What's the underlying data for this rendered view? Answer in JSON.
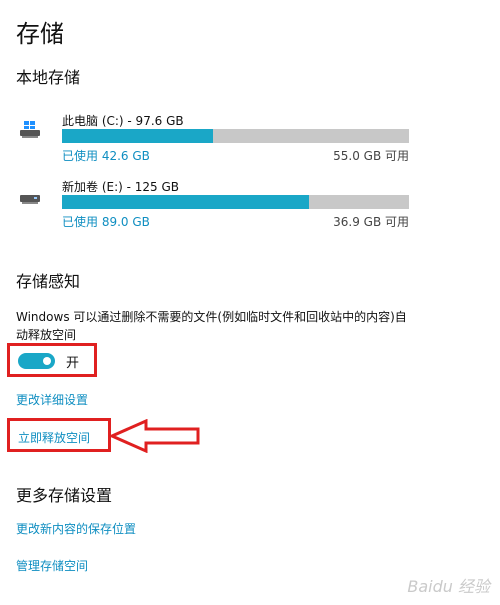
{
  "page": {
    "title": "存储"
  },
  "local_storage": {
    "heading": "本地存储",
    "drives": [
      {
        "name": "此电脑 (C:) - 97.6 GB",
        "used": "已使用 42.6 GB",
        "free": "55.0 GB 可用",
        "used_fraction": 0.436,
        "icon": "windows-drive-icon"
      },
      {
        "name": "新加卷 (E:) - 125 GB",
        "used": "已使用 89.0 GB",
        "free": "36.9 GB 可用",
        "used_fraction": 0.712,
        "icon": "drive-icon"
      }
    ]
  },
  "storage_sense": {
    "heading": "存储感知",
    "description": "Windows 可以通过删除不需要的文件(例如临时文件和回收站中的内容)自动释放空间",
    "toggle_label": "开",
    "toggle_on": true,
    "change_settings_link": "更改详细设置",
    "free_now_link": "立即释放空间"
  },
  "more_settings": {
    "heading": "更多存储设置",
    "links": [
      "更改新内容的保存位置",
      "管理存储空间"
    ]
  },
  "watermark": "Baidu 经验",
  "colors": {
    "accent": "#1aa7c7",
    "link": "#0f8ec1",
    "highlight": "#e02020",
    "bar_bg": "#c8c8c8"
  }
}
